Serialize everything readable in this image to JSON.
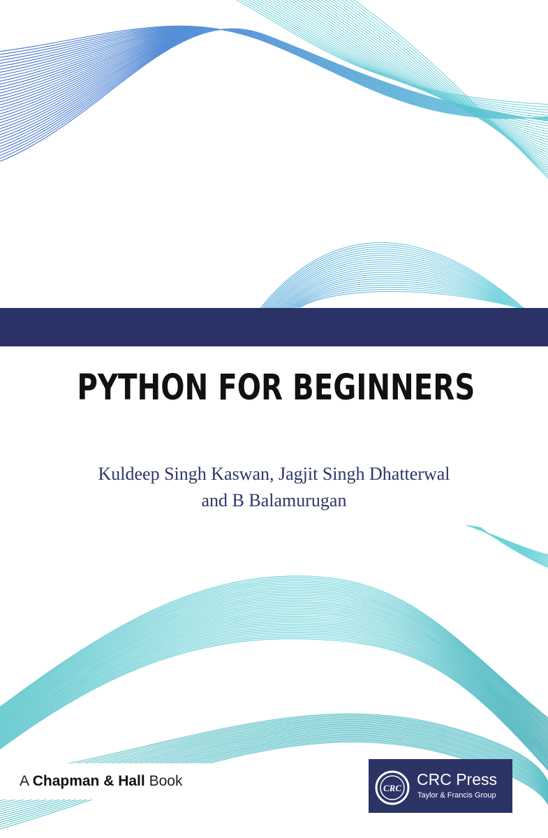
{
  "book": {
    "title": "PYTHON FOR BEGINNERS",
    "authors_line1": "Kuldeep Singh Kaswan, Jagjit Singh Dhatterwal",
    "authors_line2": "and B Balamurugan"
  },
  "imprint": {
    "prefix": "A",
    "brand": "Chapman & Hall",
    "suffix": "Book"
  },
  "publisher": {
    "seal_text": "CRC",
    "name": "CRC Press",
    "group": "Taylor & Francis Group"
  },
  "colors": {
    "band": "#2b3266",
    "title": "#111111",
    "authors": "#2f3568",
    "publisher_bg": "#2c3466",
    "wave_blue": "#3a6fc8",
    "wave_cyan": "#5fcfd6",
    "wave_teal": "#3fb6be"
  },
  "icons": {
    "publisher_seal": "crc-seal-icon",
    "decoration": "wave-lines-icon"
  }
}
